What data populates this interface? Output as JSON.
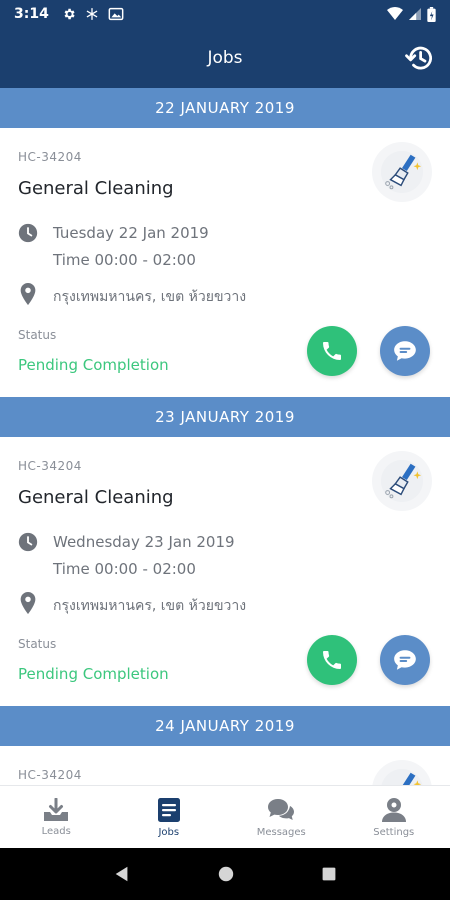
{
  "status_bar": {
    "time": "3:14"
  },
  "app_bar": {
    "title": "Jobs"
  },
  "groups": [
    {
      "date_header": "22 JANUARY 2019",
      "job": {
        "id": "HC-34204",
        "title": "General Cleaning",
        "date": "Tuesday 22 Jan 2019",
        "time": "Time 00:00 - 02:00",
        "location": "กรุงเทพมหานคร, เขต ห้วยขวาง",
        "status_label": "Status",
        "status": "Pending Completion"
      }
    },
    {
      "date_header": "23 JANUARY 2019",
      "job": {
        "id": "HC-34204",
        "title": "General Cleaning",
        "date": "Wednesday 23 Jan 2019",
        "time": "Time 00:00 - 02:00",
        "location": "กรุงเทพมหานคร, เขต ห้วยขวาง",
        "status_label": "Status",
        "status": "Pending Completion"
      }
    },
    {
      "date_header": "24 JANUARY 2019",
      "job": {
        "id": "HC-34204"
      }
    }
  ],
  "bottom_nav": [
    {
      "label": "Leads",
      "icon": "download-tray-icon"
    },
    {
      "label": "Jobs",
      "icon": "document-list-icon",
      "active": true
    },
    {
      "label": "Messages",
      "icon": "chat-bubbles-icon"
    },
    {
      "label": "Settings",
      "icon": "user-gear-icon"
    }
  ],
  "colors": {
    "primary_dark": "#1b3f6e",
    "header_blue": "#5b8dc8",
    "status_green": "#3cc77e",
    "call_green": "#2fc17a"
  }
}
